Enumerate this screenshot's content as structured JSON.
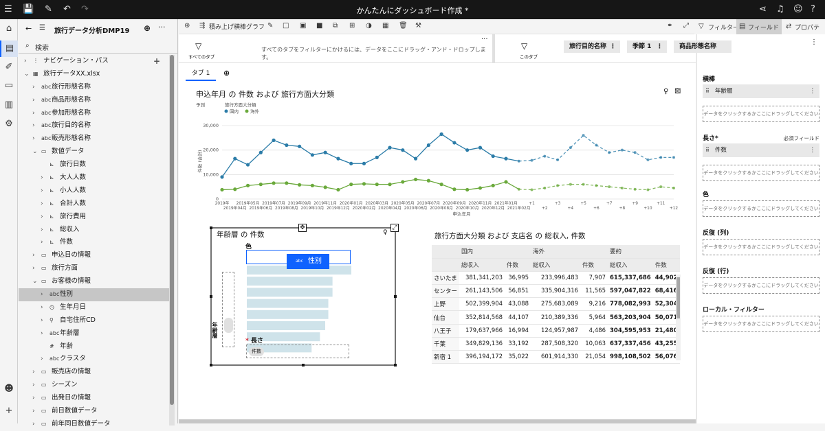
{
  "topbar": {
    "title": "かんたんにダッシュボード作成 *"
  },
  "datasource": {
    "title": "旅行データ分析DMP19",
    "search_placeholder": "検索"
  },
  "tree": [
    {
      "label": "ナビゲーション・パス",
      "level": 1,
      "chev": "›",
      "icon": "⋮",
      "add": "+"
    },
    {
      "label": "旅行データXX.xlsx",
      "level": 1,
      "chev": "⌄",
      "icon": "▦"
    },
    {
      "label": "旅行形態名称",
      "level": 2,
      "chev": "›",
      "icon": "abc"
    },
    {
      "label": "商品形態名称",
      "level": 2,
      "chev": "›",
      "icon": "abc"
    },
    {
      "label": "参加形態名称",
      "level": 2,
      "chev": "›",
      "icon": "abc"
    },
    {
      "label": "旅行目的名称",
      "level": 2,
      "chev": "›",
      "icon": "abc"
    },
    {
      "label": "販売形態名称",
      "level": 2,
      "chev": "›",
      "icon": "abc"
    },
    {
      "label": "数値データ",
      "level": 2,
      "chev": "⌄",
      "icon": "▭"
    },
    {
      "label": "旅行日数",
      "level": 3,
      "chev": "",
      "icon": "⊾"
    },
    {
      "label": "大人人数",
      "level": 3,
      "chev": "›",
      "icon": "⊾"
    },
    {
      "label": "小人人数",
      "level": 3,
      "chev": "›",
      "icon": "⊾"
    },
    {
      "label": "合計人数",
      "level": 3,
      "chev": "›",
      "icon": "⊾"
    },
    {
      "label": "旅行費用",
      "level": 3,
      "chev": "›",
      "icon": "⊾"
    },
    {
      "label": "総収入",
      "level": 3,
      "chev": "›",
      "icon": "⊾"
    },
    {
      "label": "件数",
      "level": 3,
      "chev": "›",
      "icon": "⊾"
    },
    {
      "label": "申込日の情報",
      "level": 2,
      "chev": "›",
      "icon": "▭"
    },
    {
      "label": "旅行方面",
      "level": 2,
      "chev": "›",
      "icon": "▭"
    },
    {
      "label": "お客様の情報",
      "level": 2,
      "chev": "⌄",
      "icon": "▭"
    },
    {
      "label": "性別",
      "level": 3,
      "chev": "›",
      "icon": "abc",
      "selected": true
    },
    {
      "label": "生年月日",
      "level": 3,
      "chev": "›",
      "icon": "◷"
    },
    {
      "label": "自宅住所CD",
      "level": 3,
      "chev": "›",
      "icon": "⚲"
    },
    {
      "label": "年齢層",
      "level": 3,
      "chev": "›",
      "icon": "abc"
    },
    {
      "label": "年齢",
      "level": 3,
      "chev": "",
      "icon": "#"
    },
    {
      "label": "クラスタ",
      "level": 3,
      "chev": "›",
      "icon": "abc"
    },
    {
      "label": "販売店の情報",
      "level": 2,
      "chev": "›",
      "icon": "▭"
    },
    {
      "label": "シーズン",
      "level": 2,
      "chev": "›",
      "icon": "▭"
    },
    {
      "label": "出発日の情報",
      "level": 2,
      "chev": "›",
      "icon": "▭"
    },
    {
      "label": "前日数値データ",
      "level": 2,
      "chev": "›",
      "icon": "▭"
    },
    {
      "label": "前年同日数値データ",
      "level": 2,
      "chev": "›",
      "icon": "▭"
    }
  ],
  "toolbar": {
    "viz_type": "積み上げ横棒グラフ",
    "filter": "フィルター",
    "field": "フィールド",
    "properties": "プロパティー"
  },
  "filterbar": {
    "all_tabs_label": "すべてのタブ",
    "all_tabs_hint": "すべてのタブをフィルターにかけるには、データをここにドラッグ・アンド・ドロップします。",
    "this_tab_label": "このタブ",
    "chips": [
      "旅行目的名称",
      "季節 1",
      "商品形態名称"
    ]
  },
  "tabs": [
    {
      "label": "タブ 1"
    }
  ],
  "chart_data": [
    {
      "type": "line",
      "title": "申込年月 の 件数 および 旅行方面大分類",
      "legend_title": "旅行方面大分類",
      "forecast_label": "予測",
      "ylabel": "件数 (合計)",
      "xlabel": "申込年月",
      "ylim": [
        0,
        30000
      ],
      "yticks": [
        "0",
        "10,000",
        "20,000",
        "30,000"
      ],
      "categories": [
        "2019年",
        "2019年04月",
        "2019年05月",
        "2019年06月",
        "2019年07月",
        "2019年08月",
        "2019年09月",
        "2019年10月",
        "2019年11月",
        "2019年12月",
        "2020年01月",
        "2020年02月",
        "2020年03月",
        "2020年04月",
        "2020年05月",
        "2020年06月",
        "2020年07月",
        "2020年08月",
        "2020年09月",
        "2020年10月",
        "2020年11月",
        "2020年12月",
        "2021年01月",
        "2021年02月",
        "+1",
        "+2",
        "+3",
        "+4",
        "+5",
        "+6",
        "+7",
        "+8",
        "+9",
        "+10",
        "+11",
        "+12"
      ],
      "forecast_from_index": 23,
      "series": [
        {
          "name": "国内",
          "color": "#2b7ca8",
          "values": [
            9000,
            16500,
            14000,
            19000,
            24000,
            22000,
            21500,
            18000,
            19000,
            16500,
            14500,
            14500,
            17000,
            21000,
            20000,
            16500,
            22000,
            26500,
            23000,
            20000,
            21000,
            17500,
            16500,
            15500,
            15800,
            17500,
            16000,
            21000,
            26000,
            22000,
            19000,
            20000,
            19000,
            16000,
            17000,
            17000
          ]
        },
        {
          "name": "海外",
          "color": "#6aa93b",
          "values": [
            3800,
            4000,
            5500,
            6000,
            6500,
            6500,
            5800,
            5500,
            4800,
            3800,
            6000,
            6200,
            6000,
            6000,
            7000,
            8000,
            7500,
            6000,
            4000,
            3800,
            4500,
            5500,
            7000,
            4000,
            3800,
            4500,
            5500,
            6000,
            6000,
            5500,
            5000,
            4500,
            4000,
            3800,
            5000,
            4500
          ]
        }
      ]
    },
    {
      "type": "bar",
      "title": "年齢層 の 件数",
      "color_label": "色",
      "length_label": "長さ",
      "length_chip": "件数",
      "yaxis_label": "年齢層",
      "drag_chip": "性別",
      "values": [
        1,
        0.82,
        0.82,
        0.78,
        0.78,
        0.75,
        0.7,
        0.62
      ]
    }
  ],
  "table": {
    "title": "旅行方面大分類 および 支店名 の 総収入, 件数",
    "groups": [
      "国内",
      "海外",
      "要約"
    ],
    "cols": [
      "総収入",
      "件数",
      "総収入",
      "件数",
      "総収入",
      "件数"
    ],
    "rows": [
      {
        "label": "さいたま",
        "v": [
          "381,341,203",
          "36,995",
          "233,996,483",
          "7,907",
          "615,337,686",
          "44,902"
        ]
      },
      {
        "label": "センター",
        "v": [
          "261,143,506",
          "56,851",
          "335,904,316",
          "11,565",
          "597,047,822",
          "68,416"
        ]
      },
      {
        "label": "上野",
        "v": [
          "502,399,904",
          "43,088",
          "275,683,089",
          "9,216",
          "778,082,993",
          "52,304"
        ]
      },
      {
        "label": "仙台",
        "v": [
          "352,814,568",
          "44,107",
          "210,389,336",
          "5,964",
          "563,203,904",
          "50,071"
        ]
      },
      {
        "label": "八王子",
        "v": [
          "179,637,966",
          "16,994",
          "124,957,987",
          "4,486",
          "304,595,953",
          "21,480"
        ]
      },
      {
        "label": "千葉",
        "v": [
          "349,829,136",
          "33,192",
          "287,508,320",
          "10,063",
          "637,337,456",
          "43,255"
        ]
      },
      {
        "label": "新宿 1",
        "v": [
          "396,194,172",
          "35,022",
          "601,914,330",
          "21,054",
          "998,108,502",
          "56,076"
        ]
      }
    ]
  },
  "props": {
    "slots": [
      {
        "title": "横棒",
        "pill": "年齢層",
        "drop": "データをクリックするかここにドラッグしてください"
      },
      {
        "title": "長さ*",
        "required": "必須フィールド",
        "pill": "件数",
        "drop": "データをクリックするかここにドラッグしてください"
      },
      {
        "title": "色",
        "drop": "データをクリックするかここにドラッグしてください"
      },
      {
        "title": "反復 (列)",
        "drop": "データをクリックするかここにドラッグしてください"
      },
      {
        "title": "反復 (行)",
        "drop": "データをクリックするかここにドラッグしてください"
      },
      {
        "title": "ローカル・フィルター",
        "drop": "データをクリックするかここにドラッグしてください"
      }
    ]
  }
}
